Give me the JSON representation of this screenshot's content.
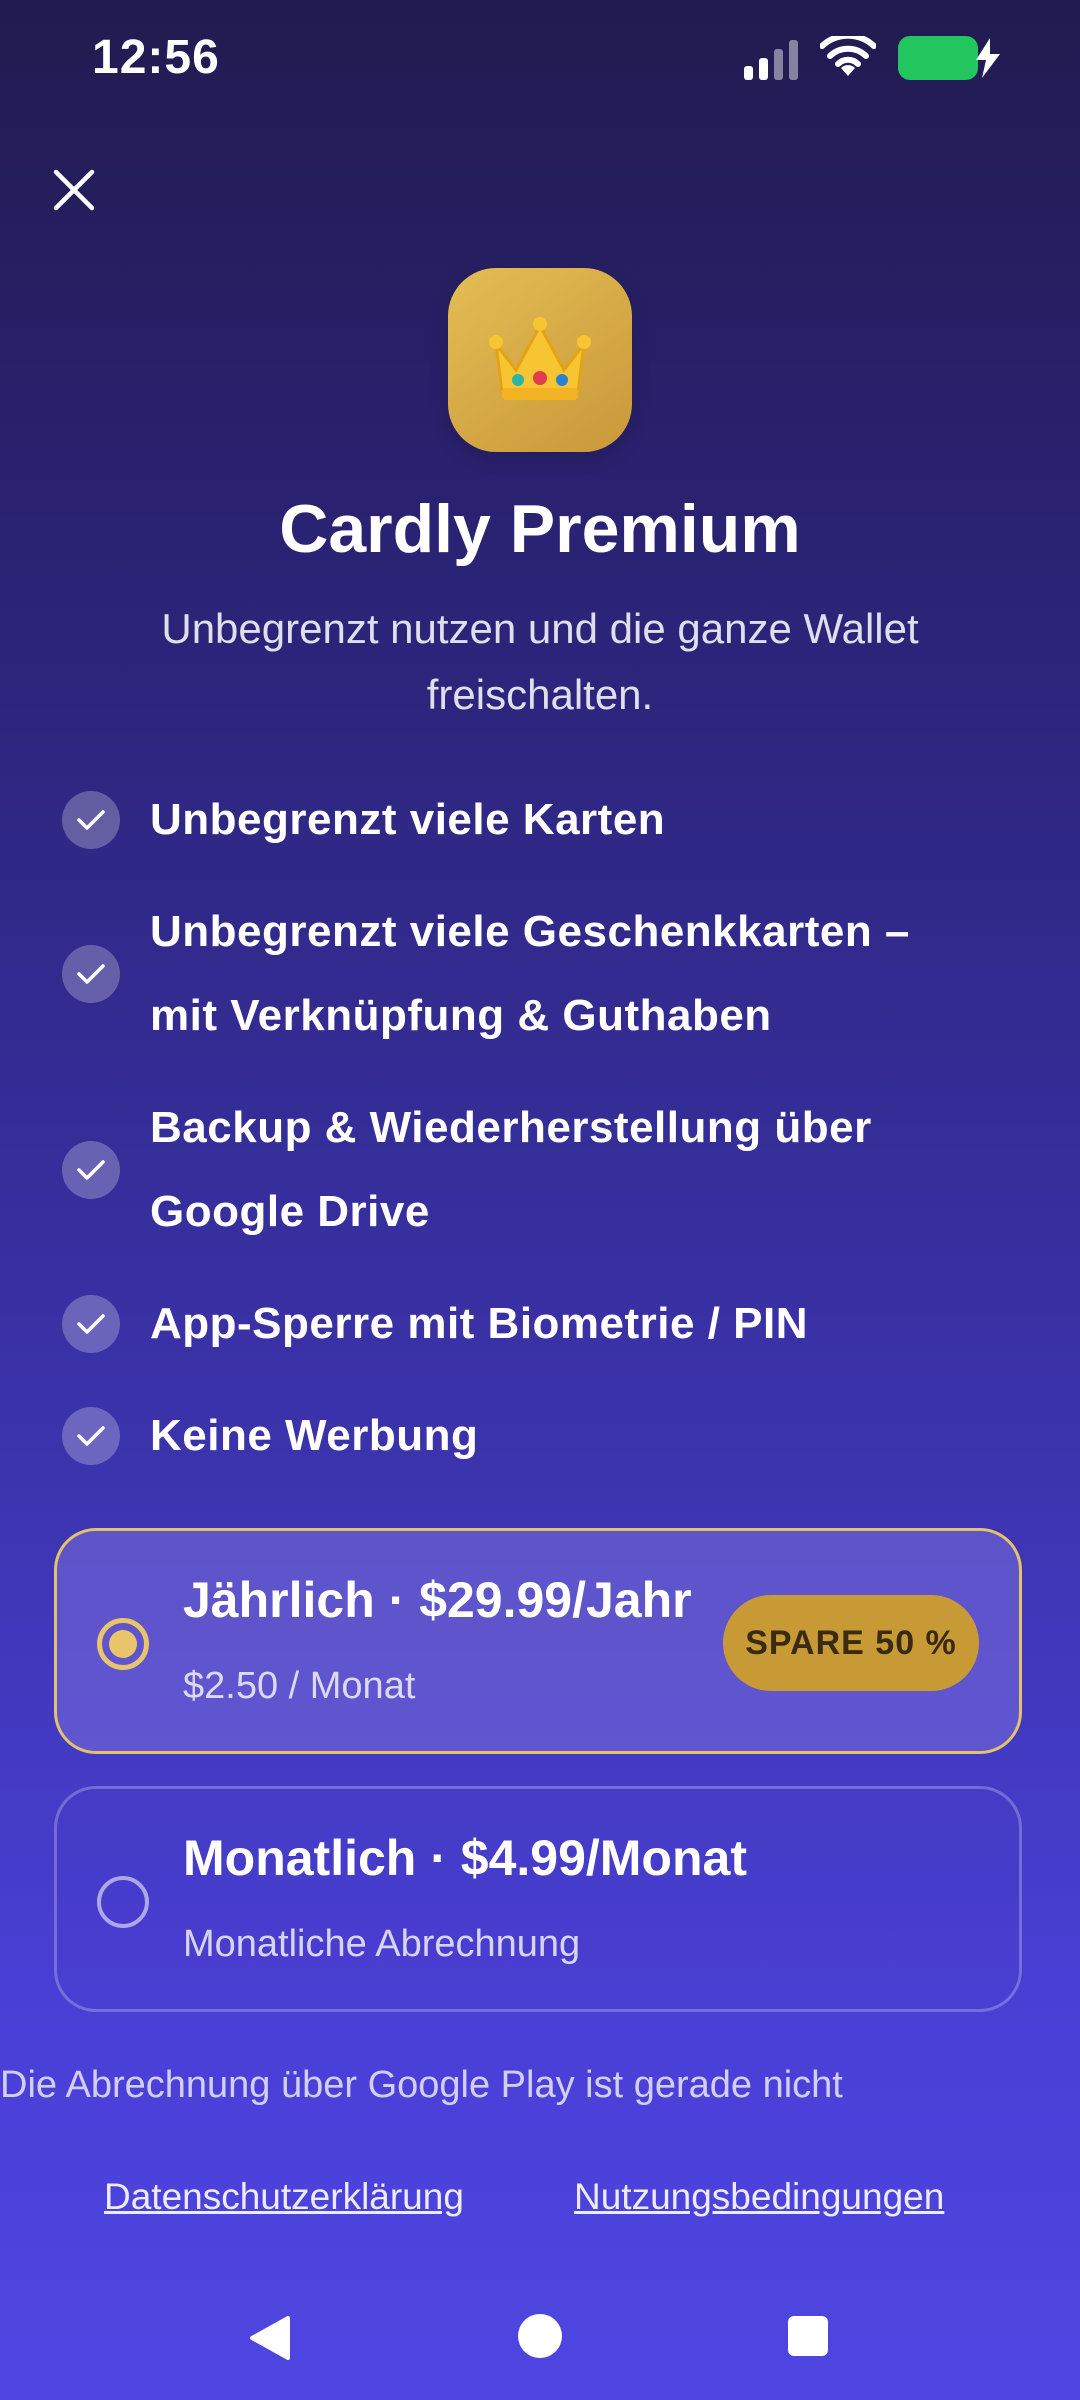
{
  "status_bar": {
    "time": "12:56",
    "icons": [
      "signal-icon",
      "wifi-icon",
      "battery-charging-icon"
    ],
    "battery_color": "#22c55e"
  },
  "header": {
    "close_icon": "close-icon",
    "app_icon": "crown-emoji",
    "app_icon_glyph": "👑",
    "title": "Cardly Premium",
    "subtitle": "Unbegrenzt nutzen und die ganze Wallet freischalten."
  },
  "features": [
    {
      "line1": "Unbegrenzt viele Karten",
      "line2": ""
    },
    {
      "line1": "Unbegrenzt viele Geschenkkarten –",
      "line2": "mit Verknüpfung & Guthaben"
    },
    {
      "line1": "Backup & Wiederherstellung über",
      "line2": "Google Drive"
    },
    {
      "line1": "App-Sperre mit Biometrie / PIN",
      "line2": ""
    },
    {
      "line1": "Keine Werbung",
      "line2": ""
    }
  ],
  "plans": {
    "yearly": {
      "title": "Jährlich · $29.99/Jahr",
      "subtitle": "$2.50 / Monat",
      "badge": "SPARE 50 %",
      "selected": true
    },
    "monthly": {
      "title": "Monatlich · $4.99/Monat",
      "subtitle": "Monatliche Abrechnung",
      "selected": false
    }
  },
  "billing_note": "Die Abrechnung über Google Play ist gerade nicht",
  "links": {
    "privacy": "Datenschutzerklärung",
    "terms": "Nutzungsbedingungen"
  },
  "colors": {
    "accent_gold": "#e8c46a",
    "badge_bg": "#c89a36",
    "bg_top": "#221b50",
    "bg_bottom": "#4f45e0"
  }
}
